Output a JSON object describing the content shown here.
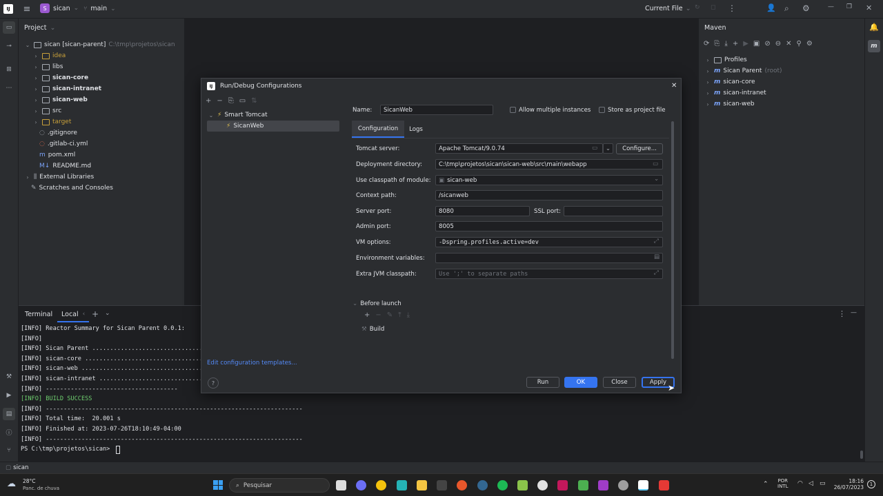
{
  "titlebar": {
    "project_name": "sican",
    "project_badge": "S",
    "branch": "main",
    "run_config": "Current File"
  },
  "project_panel": {
    "title": "Project",
    "root_label": "sican [sican-parent]",
    "root_path": "C:\\tmp\\projetos\\sican",
    "items": [
      {
        "label": "idea",
        "style": "muted-yellow"
      },
      {
        "label": "libs",
        "style": "normal"
      },
      {
        "label": "sican-core",
        "style": "bold"
      },
      {
        "label": "sican-intranet",
        "style": "bold"
      },
      {
        "label": "sican-web",
        "style": "bold"
      },
      {
        "label": "src",
        "style": "normal"
      },
      {
        "label": "target",
        "style": "yellow"
      },
      {
        "label": ".gitignore",
        "style": "normal"
      },
      {
        "label": ".gitlab-ci.yml",
        "style": "normal"
      },
      {
        "label": "pom.xml",
        "style": "normal"
      },
      {
        "label": "README.md",
        "style": "normal"
      }
    ],
    "external_libraries": "External Libraries",
    "scratches": "Scratches and Consoles"
  },
  "maven_panel": {
    "title": "Maven",
    "items": [
      {
        "label": "Profiles",
        "suffix": ""
      },
      {
        "label": "Sican Parent",
        "suffix": "(root)"
      },
      {
        "label": "sican-core",
        "suffix": ""
      },
      {
        "label": "sican-intranet",
        "suffix": ""
      },
      {
        "label": "sican-web",
        "suffix": ""
      }
    ]
  },
  "terminal": {
    "title": "Terminal",
    "tab": "Local",
    "lines": [
      "[INFO] Reactor Summary for Sican Parent 0.0.1:",
      "[INFO]",
      "[INFO] Sican Parent .................................",
      "[INFO] sican-core ...................................",
      "[INFO] sican-web ....................................",
      "[INFO] sican-intranet ...............................",
      "[INFO] -------------------------------------",
      "[INFO] BUILD SUCCESS",
      "[INFO] ------------------------------------------------------------------------",
      "[INFO] Total time:  20.001 s",
      "[INFO] Finished at: 2023-07-26T18:10:49-04:00",
      "[INFO] ------------------------------------------------------------------------",
      "PS C:\\tmp\\projetos\\sican> "
    ]
  },
  "statusbar": {
    "left": "sican"
  },
  "dialog": {
    "title": "Run/Debug Configurations",
    "tree_group": "Smart Tomcat",
    "tree_item": "SicanWeb",
    "edit_templates": "Edit configuration templates...",
    "name_label": "Name:",
    "name_value": "SicanWeb",
    "allow_multiple": "Allow multiple instances",
    "store_as_project": "Store as project file",
    "tabs": [
      "Configuration",
      "Logs"
    ],
    "fields": {
      "tomcat_server_label": "Tomcat server:",
      "tomcat_server_value": "Apache Tomcat/9.0.74",
      "configure_button": "Configure...",
      "deployment_dir_label": "Deployment directory:",
      "deployment_dir_value": "C:\\tmp\\projetos\\sican\\sican-web\\src\\main\\webapp",
      "classpath_label": "Use classpath of module:",
      "classpath_value": "sican-web",
      "context_path_label": "Context path:",
      "context_path_value": "/sicanweb",
      "server_port_label": "Server port:",
      "server_port_value": "8080",
      "ssl_port_label": "SSL port:",
      "ssl_port_value": "",
      "admin_port_label": "Admin port:",
      "admin_port_value": "8005",
      "vm_options_label": "VM options:",
      "vm_options_value": "-Dspring.profiles.active=dev",
      "env_vars_label": "Environment variables:",
      "env_vars_value": "",
      "extra_jvm_label": "Extra JVM classpath:",
      "extra_jvm_placeholder": "Use ';' to separate paths"
    },
    "before_launch": "Before launch",
    "build_task": "Build",
    "buttons": {
      "run": "Run",
      "ok": "OK",
      "close": "Close",
      "apply": "Apply"
    }
  },
  "taskbar": {
    "weather_temp": "28°C",
    "weather_desc": "Panc. de chuva",
    "search_placeholder": "Pesquisar",
    "lang_top": "POR",
    "lang_bottom": "INTL",
    "time": "18:16",
    "date": "26/07/2023"
  }
}
